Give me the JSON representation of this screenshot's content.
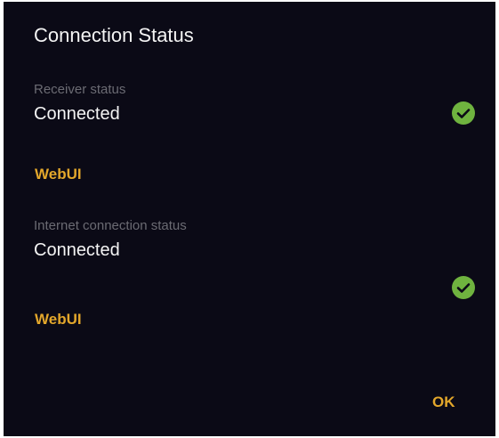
{
  "dialog": {
    "title": "Connection Status",
    "ok_label": "OK"
  },
  "sections": [
    {
      "label": "Receiver status",
      "value": "Connected",
      "link": "WebUI",
      "status_icon": "check-circle-icon"
    },
    {
      "label": "Internet connection status",
      "value": "Connected",
      "link": "WebUI",
      "status_icon": "check-circle-icon"
    }
  ],
  "colors": {
    "background": "#0b0a16",
    "accent": "#e3a72b",
    "success": "#6fb33f",
    "label": "#6b6b73"
  }
}
